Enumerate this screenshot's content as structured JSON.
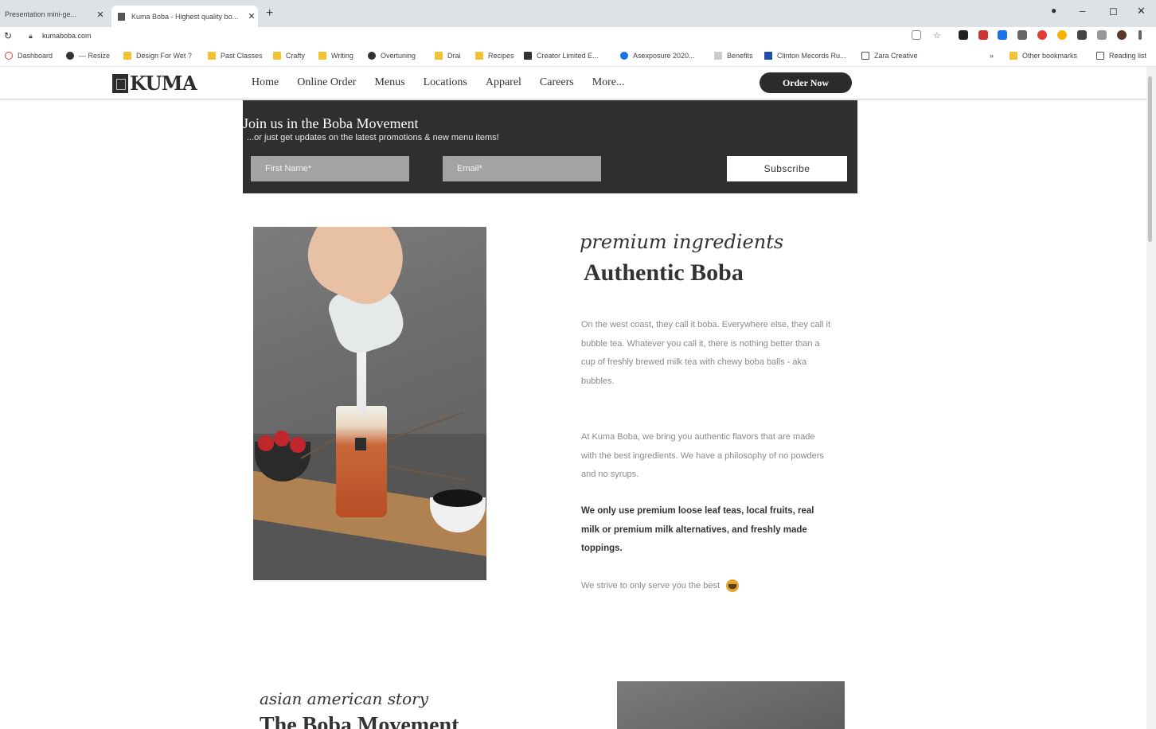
{
  "browser": {
    "tabs": [
      {
        "label": "Presentation mini-ge...",
        "active": false
      },
      {
        "label": "Kuma Boba - Highest quality bo...",
        "active": true
      }
    ],
    "new_tab": "+",
    "close_glyph": "✕",
    "window": {
      "minimize": "–",
      "maximize": "◻",
      "close": "✕"
    },
    "url": "kumaboba.com",
    "bookmarks": [
      "Dashboard",
      "— Resize",
      "Design For Wet ?",
      "Past Classes",
      "Crafty",
      "Writing",
      "Overtuning",
      "Drai",
      "Recipes",
      "Creator Limited E...",
      "Asexposure 2020...",
      "Benefits",
      "Clinton Mecords Ru...",
      "Zara Creative",
      "Other bookmarks",
      "Reading list"
    ]
  },
  "site": {
    "logo_text": "KUMA",
    "nav": [
      "Home",
      "Online Order",
      "Menus",
      "Locations",
      "Apparel",
      "Careers",
      "More..."
    ],
    "order_button": "Order Now"
  },
  "newsletter": {
    "title": "Join us in the Boba Movement",
    "subtitle": "...or just get updates on the latest promotions & new menu items!",
    "first_name_placeholder": "First Name*",
    "email_placeholder": "Email*",
    "subscribe_label": "Subscribe"
  },
  "authentic": {
    "eyebrow": "premium ingredients",
    "heading": "Authentic Boba",
    "p1": "On the west coast, they call it boba. Everywhere else, they call it bubble tea. Whatever you call it, there is nothing better than a cup of freshly brewed milk tea with chewy boba balls - aka bubbles.",
    "p2": "At Kuma Boba, we bring you authentic flavors that are made with the best ingredients. We have a philosophy of no powders and no syrups.",
    "p3": "We only use premium loose leaf teas, local fruits, real milk or premium milk alternatives, and freshly made toppings.",
    "strive": "We strive to only serve you the best"
  },
  "story": {
    "eyebrow": "asian american story",
    "heading": "The Boba Movement"
  }
}
